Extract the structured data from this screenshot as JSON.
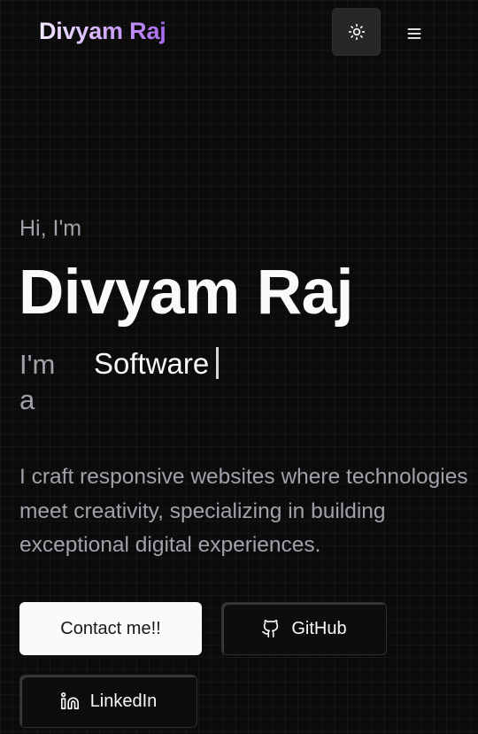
{
  "header": {
    "brand": "Divyam Raj",
    "theme_toggle_icon": "sun-icon",
    "menu_icon": "hamburger-menu-icon"
  },
  "hero": {
    "greeting": "Hi, I'm",
    "name": "Divyam Raj",
    "role_prefix": "I'm a",
    "role_typed": "Software",
    "bio": "I craft responsive websites where technologies meet creativity, specializing in building exceptional digital experiences."
  },
  "actions": {
    "contact_label": "Contact me!!",
    "github_label": "GitHub",
    "github_icon": "github-icon",
    "linkedin_label": "LinkedIn",
    "linkedin_icon": "linkedin-icon"
  },
  "colors": {
    "background": "#0b0b0c",
    "primary_button": "#fafafa",
    "brand_gradient_end": "#a967ee",
    "muted_text": "#a1a1aa"
  }
}
